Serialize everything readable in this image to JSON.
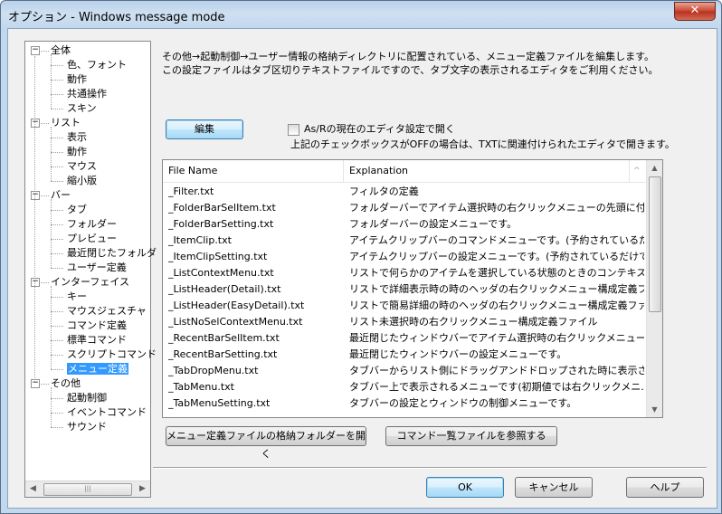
{
  "window": {
    "title": "オプション - Windows message mode",
    "close_glyph": "✕"
  },
  "tree": {
    "items": [
      {
        "label": "全体",
        "level": 0,
        "expander": "−"
      },
      {
        "label": "色、フォント",
        "level": 1
      },
      {
        "label": "動作",
        "level": 1
      },
      {
        "label": "共通操作",
        "level": 1
      },
      {
        "label": "スキン",
        "level": 1
      },
      {
        "label": "リスト",
        "level": 0,
        "expander": "−"
      },
      {
        "label": "表示",
        "level": 1
      },
      {
        "label": "動作",
        "level": 1
      },
      {
        "label": "マウス",
        "level": 1
      },
      {
        "label": "縮小版",
        "level": 1
      },
      {
        "label": "バー",
        "level": 0,
        "expander": "−"
      },
      {
        "label": "タブ",
        "level": 1
      },
      {
        "label": "フォルダー",
        "level": 1
      },
      {
        "label": "プレビュー",
        "level": 1
      },
      {
        "label": "最近閉じたフォルダ",
        "level": 1
      },
      {
        "label": "ユーザー定義",
        "level": 1
      },
      {
        "label": "インターフェイス",
        "level": 0,
        "expander": "−"
      },
      {
        "label": "キー",
        "level": 1
      },
      {
        "label": "マウスジェスチャ",
        "level": 1
      },
      {
        "label": "コマンド定義",
        "level": 1
      },
      {
        "label": "標準コマンド",
        "level": 1
      },
      {
        "label": "スクリプトコマンド",
        "level": 1
      },
      {
        "label": "メニュー定義",
        "level": 1,
        "selected": true
      },
      {
        "label": "その他",
        "level": 0,
        "expander": "−"
      },
      {
        "label": "起動制御",
        "level": 1
      },
      {
        "label": "イベントコマンド",
        "level": 1
      },
      {
        "label": "サウンド",
        "level": 1
      }
    ],
    "scroll_grip": "|||"
  },
  "content": {
    "desc_line1": "その他→起動制御→ユーザー情報の格納ディレクトリに配置されている、メニュー定義ファイルを編集します。",
    "desc_line2": "この設定ファイルはタブ区切りテキストファイルですので、タブ文字の表示されるエディタをご利用ください。",
    "edit_button": "編集",
    "checkbox_label": "As/Rの現在のエディタ設定で開く",
    "checkbox_checked": false,
    "checkbox_note": "上記のチェックボックスがOFFの場合は、TXTに関連付けられたエディタで開きます。",
    "list": {
      "columns": [
        "File Name",
        "Explanation"
      ],
      "rows": [
        {
          "file": "_Filter.txt",
          "explanation": "フィルタの定義"
        },
        {
          "file": "_FolderBarSelItem.txt",
          "explanation": "フォルダーバーでアイテム選択時の右クリックメニューの先頭に付..."
        },
        {
          "file": "_FolderBarSetting.txt",
          "explanation": "フォルダーバーの設定メニューです。"
        },
        {
          "file": "_ItemClip.txt",
          "explanation": "アイテムクリップバーのコマンドメニューです。(予約されているだけ..."
        },
        {
          "file": "_ItemClipSetting.txt",
          "explanation": "アイテムクリップバーの設定メニューです。(予約されているだけで..."
        },
        {
          "file": "_ListContextMenu.txt",
          "explanation": "リストで何らかのアイテムを選択している状態のときのコンテキスト..."
        },
        {
          "file": "_ListHeader(Detail).txt",
          "explanation": "リストで詳細表示時の時のヘッダの右クリックメニュー構成定義ファ..."
        },
        {
          "file": "_ListHeader(EasyDetail).txt",
          "explanation": "リストで簡易詳細の時のヘッダの右クリックメニュー構成定義ファ..."
        },
        {
          "file": "_ListNoSelContextMenu.txt",
          "explanation": "リスト未選択時の右クリックメニュー構成定義ファイル"
        },
        {
          "file": "_RecentBarSelItem.txt",
          "explanation": "最近閉じたウィンドウバーでアイテム選択時の右クリックメニュー..."
        },
        {
          "file": "_RecentBarSetting.txt",
          "explanation": "最近閉じたウィンドウバーの設定メニューです。"
        },
        {
          "file": "_TabDropMenu.txt",
          "explanation": "タブバーからリスト側にドラッグアンドドロップされた時に表示される..."
        },
        {
          "file": "_TabMenu.txt",
          "explanation": "タブバー上で表示されるメニューです(初期値では右クリックメニ..."
        },
        {
          "file": "_TabMenuSetting.txt",
          "explanation": "タブバーの設定とウィンドウの制御メニューです。"
        }
      ],
      "sort_indicator": "^",
      "scroll_up": "▲",
      "scroll_down": "▼"
    },
    "open_folder_button": "メニュー定義ファイルの格納フォルダーを開く",
    "browse_commands_button": "コマンド一覧ファイルを参照する"
  },
  "footer": {
    "ok": "OK",
    "cancel": "キャンセル",
    "help": "ヘルプ"
  }
}
